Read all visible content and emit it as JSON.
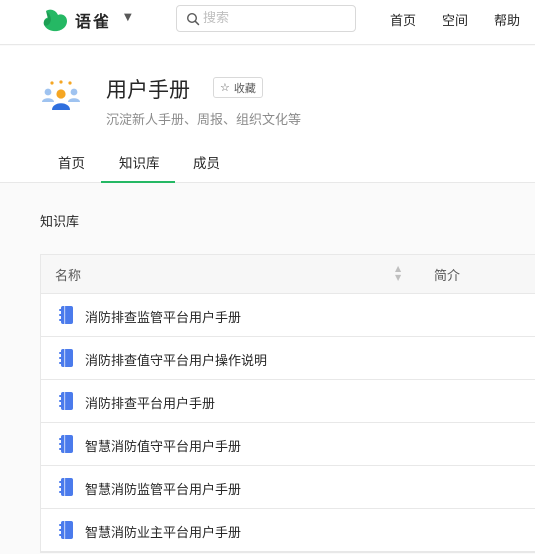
{
  "app": {
    "name": "语雀"
  },
  "search": {
    "placeholder": "搜索"
  },
  "nav": {
    "items": [
      "首页",
      "空间",
      "帮助"
    ]
  },
  "header": {
    "title": "用户手册",
    "favorite_label": "收藏",
    "description": "沉淀新人手册、周报、组织文化等",
    "tabs": [
      "首页",
      "知识库",
      "成员"
    ],
    "active_tab": "知识库"
  },
  "content": {
    "section_title": "知识库",
    "columns": [
      "名称",
      "简介"
    ],
    "rows": [
      "消防排查监管平台用户手册",
      "消防排查值守平台用户操作说明",
      "消防排查平台用户手册",
      "智慧消防值守平台用户手册",
      "智慧消防监管平台用户手册",
      "智慧消防业主平台用户手册"
    ]
  },
  "colors": {
    "brand": "#25b864",
    "book_icon": "#4b7bec"
  },
  "icons": {
    "logo": "yuque-bird-icon",
    "search": "search-icon",
    "favorite": "star-icon",
    "team": "team-avatar-icon",
    "book": "book-icon",
    "sort": "sort-icon"
  }
}
